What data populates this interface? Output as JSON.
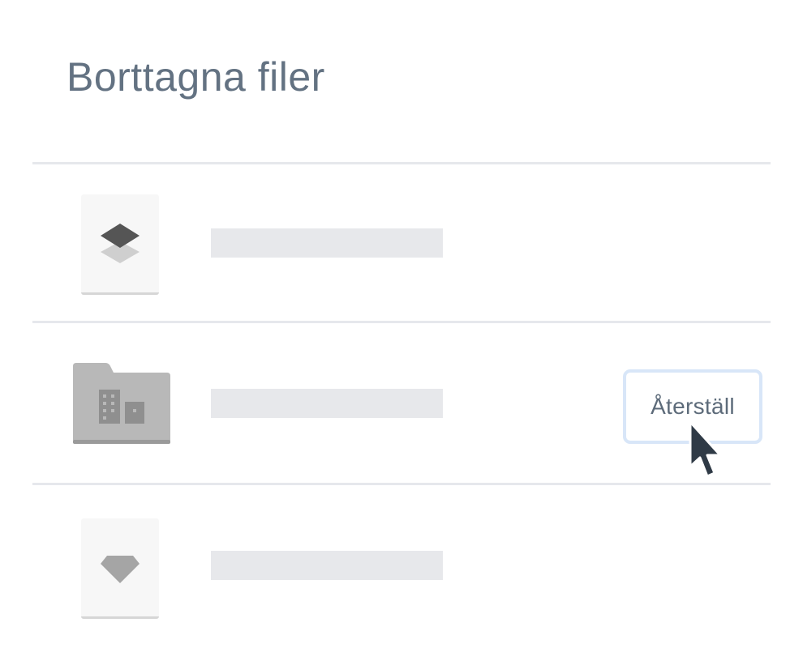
{
  "page": {
    "title": "Borttagna filer"
  },
  "files": [
    {
      "kind": "document",
      "icon": "layers-icon",
      "name": ""
    },
    {
      "kind": "folder",
      "icon": "building-folder-icon",
      "name": ""
    },
    {
      "kind": "document",
      "icon": "gem-icon",
      "name": ""
    }
  ],
  "restore_button": {
    "label": "Återställ"
  },
  "colors": {
    "title": "#637282",
    "divider": "#e6e8ec",
    "placeholder": "#e7e8eb",
    "button_border": "#d8e6f8",
    "icon_dark": "#555555",
    "icon_light": "#c9c9c9",
    "folder": "#b8b8b8",
    "cursor": "#2f3a46"
  }
}
